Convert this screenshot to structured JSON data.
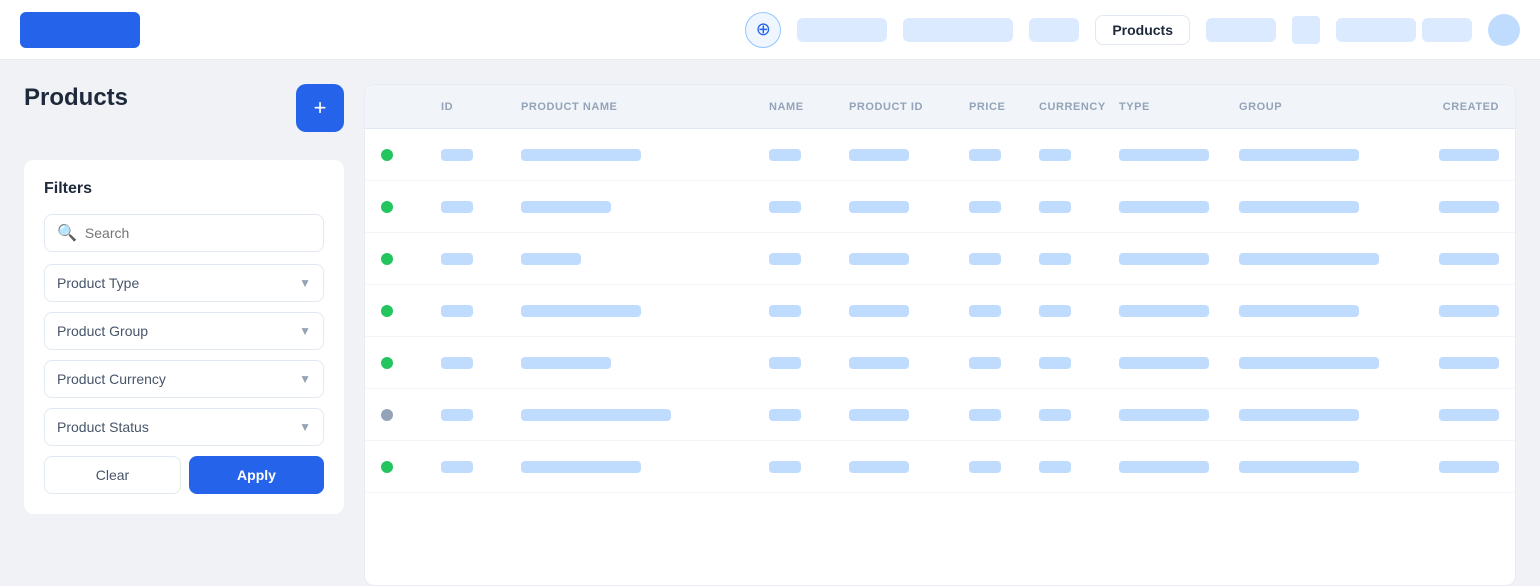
{
  "nav": {
    "add_button_label": "⊕",
    "active_tab": "Products",
    "pills": [
      "nav-pill-md",
      "nav-pill-lg",
      "nav-pill-xs",
      "nav-pill-sm"
    ]
  },
  "page": {
    "title": "Products",
    "add_button_label": "+"
  },
  "filters": {
    "section_title": "Filters",
    "search_placeholder": "Search",
    "product_type_label": "Product Type",
    "product_group_label": "Product Group",
    "product_currency_label": "Product Currency",
    "product_status_label": "Product Status",
    "clear_label": "Clear",
    "apply_label": "Apply"
  },
  "table": {
    "columns": [
      "ID",
      "PRODUCT NAME",
      "NAME",
      "PRODUCT ID",
      "PRICE",
      "CURRENCY",
      "TYPE",
      "GROUP",
      "CREATED"
    ],
    "rows": [
      {
        "status": "green"
      },
      {
        "status": "green"
      },
      {
        "status": "green"
      },
      {
        "status": "green"
      },
      {
        "status": "green"
      },
      {
        "status": "gray"
      },
      {
        "status": "green"
      }
    ]
  }
}
